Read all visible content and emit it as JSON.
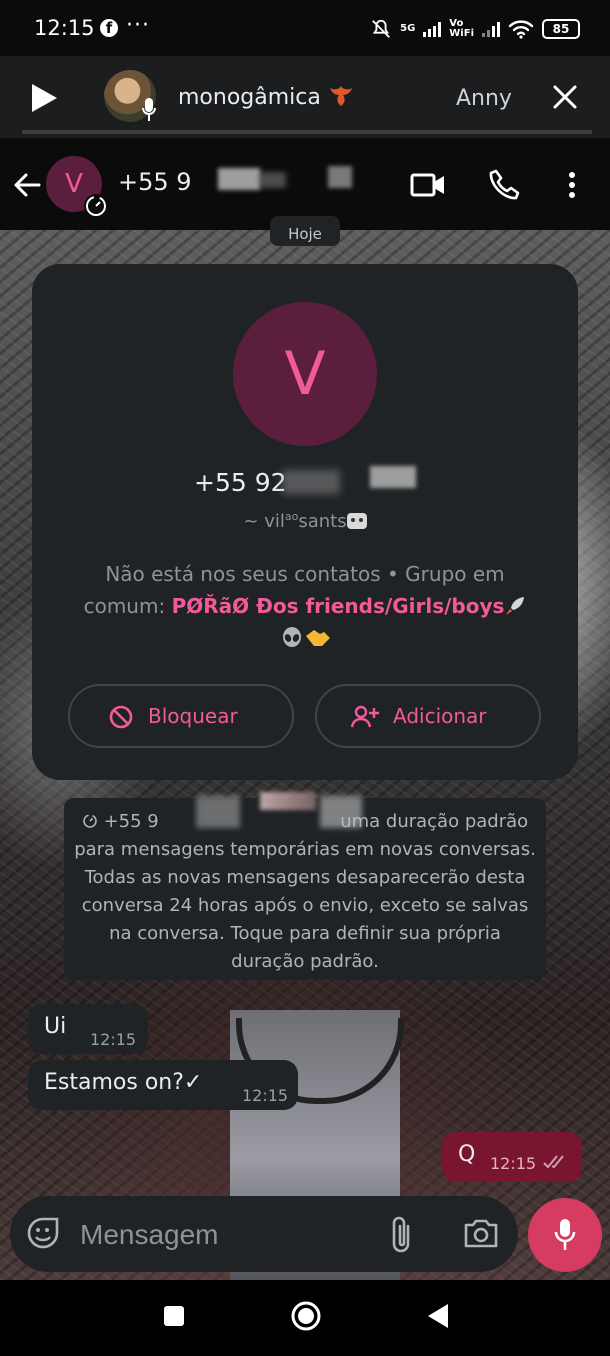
{
  "status_bar": {
    "time": "12:15",
    "facebook_glyph": "f",
    "more": "···",
    "network_5g": "5G",
    "vowifi_top": "Vo",
    "vowifi_bottom": "WiFi",
    "battery": "85"
  },
  "audio_player": {
    "title": "monogâmica",
    "subtitle": "Anny"
  },
  "header": {
    "avatar_letter": "V",
    "title": "+55 9"
  },
  "date_chip": "Hoje",
  "contact_card": {
    "avatar_letter": "V",
    "phone": "+55 92",
    "name_prefix": "~ vil",
    "name_sup": "ao",
    "name_suffix": "sants",
    "info_text": "Não está nos seus contatos • Grupo em comum: ",
    "group_name": "ΡØŘãØ Ðos friends/Girls/boys",
    "block_label": "Bloquear",
    "add_label": "Adicionar"
  },
  "system_message": {
    "lead": "+55 9",
    "text": "uma duração padrão para mensagens temporárias em novas conversas. Todas as novas mensagens desaparecerão desta conversa 24 horas após o envio, exceto se salvas na conversa. Toque para definir sua própria duração padrão."
  },
  "messages": [
    {
      "direction": "in",
      "text": "Ui",
      "time": "12:15"
    },
    {
      "direction": "in",
      "text": "Estamos on?✓",
      "time": "12:15"
    },
    {
      "direction": "out",
      "text": "Q",
      "time": "12:15"
    }
  ],
  "composer": {
    "placeholder": "Mensagem"
  },
  "colors": {
    "accent": "#f25a99",
    "mic_button": "#d63b62",
    "out_bubble": "#7a1530",
    "panel": "#202326"
  }
}
